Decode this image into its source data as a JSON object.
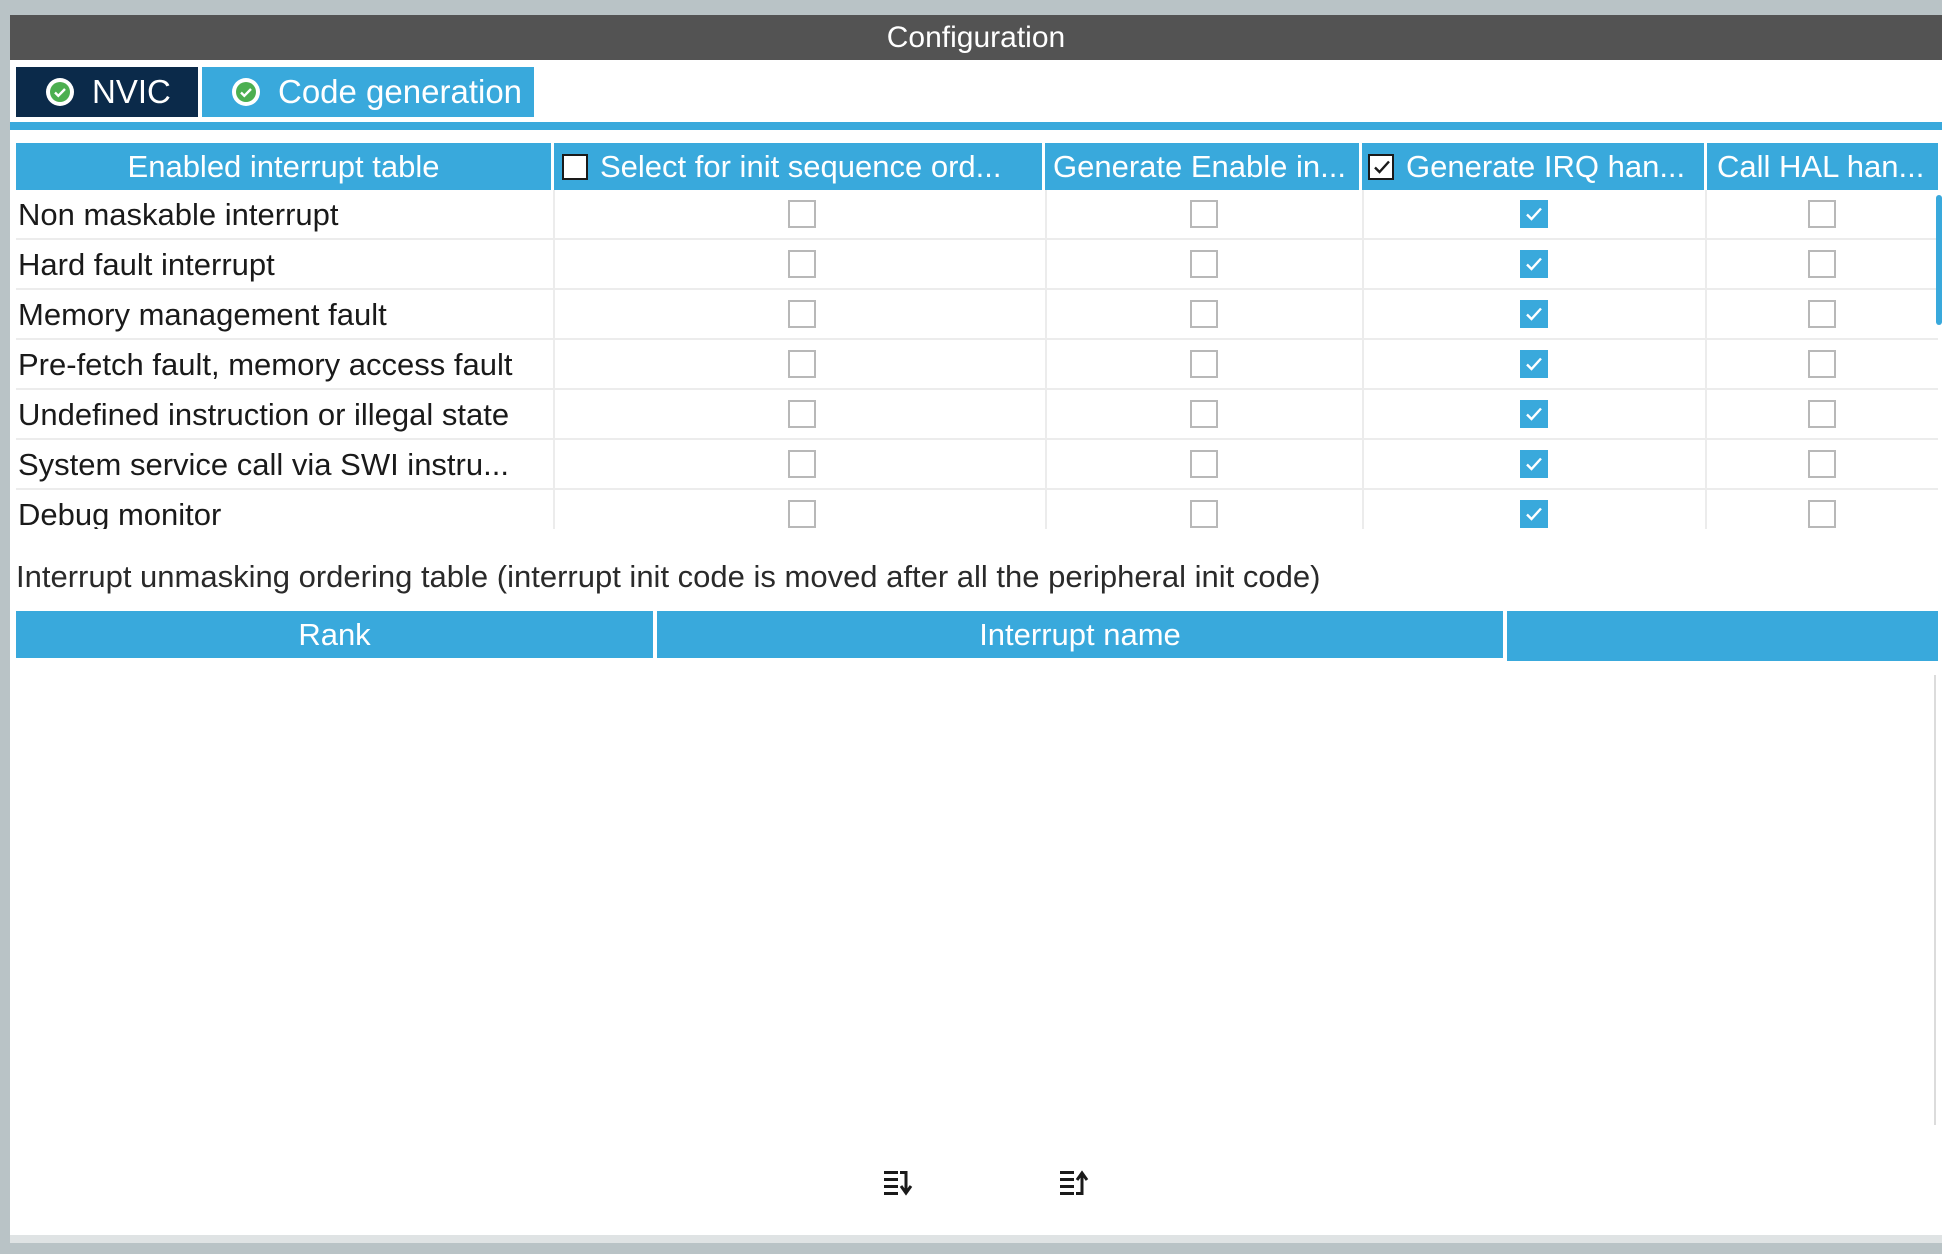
{
  "window": {
    "title": "Configuration"
  },
  "tabs": [
    {
      "label": "NVIC",
      "icon": "check-circle-icon",
      "active": true
    },
    {
      "label": "Code generation",
      "icon": "check-circle-icon",
      "active": false
    }
  ],
  "enabled_table": {
    "headers": [
      "Enabled interrupt table",
      "Select for init sequence ord...",
      "Generate Enable in...",
      "Generate IRQ han...",
      "Call HAL han..."
    ],
    "header_checkboxes": {
      "select_init_sequence": false,
      "generate_irq_handler": true
    },
    "rows": [
      {
        "name": "Non maskable interrupt",
        "select_init": false,
        "generate_enable": false,
        "generate_irq": true,
        "call_hal": false
      },
      {
        "name": "Hard fault interrupt",
        "select_init": false,
        "generate_enable": false,
        "generate_irq": true,
        "call_hal": false
      },
      {
        "name": "Memory management fault",
        "select_init": false,
        "generate_enable": false,
        "generate_irq": true,
        "call_hal": false
      },
      {
        "name": "Pre-fetch fault, memory access fault",
        "select_init": false,
        "generate_enable": false,
        "generate_irq": true,
        "call_hal": false
      },
      {
        "name": "Undefined instruction or illegal state",
        "select_init": false,
        "generate_enable": false,
        "generate_irq": true,
        "call_hal": false
      },
      {
        "name": "System service call via SWI instru...",
        "select_init": false,
        "generate_enable": false,
        "generate_irq": true,
        "call_hal": false
      },
      {
        "name": "Debug monitor",
        "select_init": false,
        "generate_enable": false,
        "generate_irq": true,
        "call_hal": false
      }
    ]
  },
  "ordering": {
    "label": "Interrupt unmasking ordering table (interrupt init code is moved after all the peripheral init code)",
    "headers": [
      "Rank",
      "Interrupt name",
      ""
    ],
    "rows": [],
    "buttons": {
      "move_down_icon": "sort-move-down-icon",
      "move_up_icon": "sort-move-up-icon"
    }
  },
  "colors": {
    "accent": "#39a9dc",
    "title_bar": "#535353",
    "active_tab": "#0b2a4a"
  }
}
